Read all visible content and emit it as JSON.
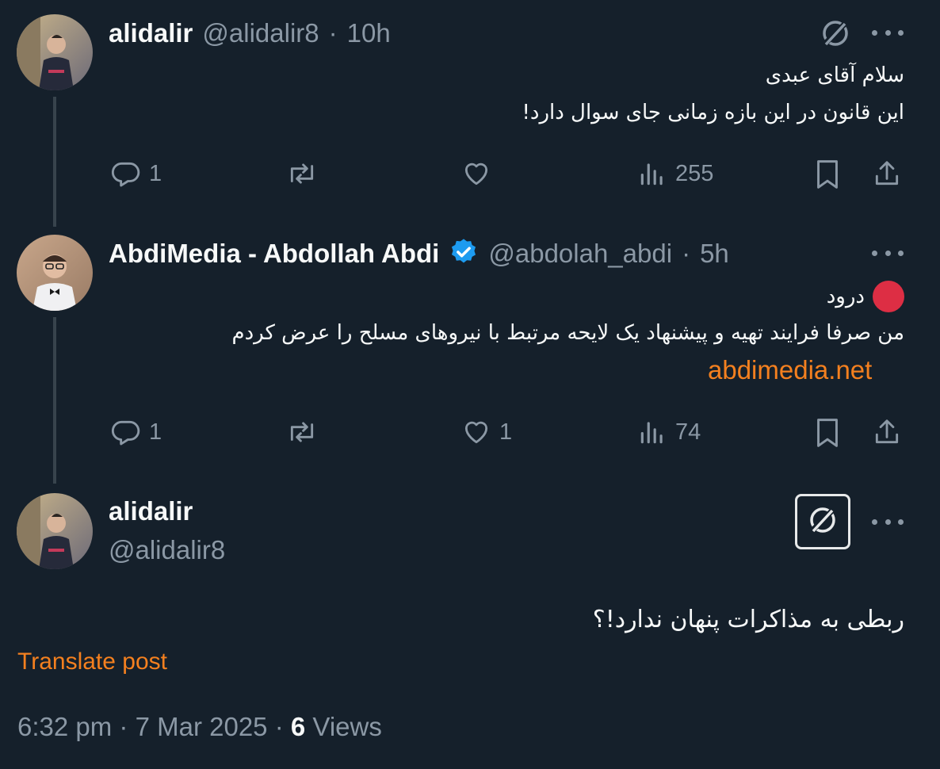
{
  "tweet1": {
    "name": "alidalir",
    "handle": "@alidalir8",
    "sep": "·",
    "time": "10h",
    "line1": "سلام آقای عبدی",
    "line2": "این قانون در این بازه زمانی جای سوال دارد!",
    "replies": "1",
    "likes": "",
    "views": "255"
  },
  "tweet2": {
    "name": "AbdiMedia - Abdollah Abdi",
    "handle": "@abdolah_abdi",
    "sep": "·",
    "time": "5h",
    "line1": "درود",
    "line2": "من صرفا فرایند تهیه و پیشنهاد یک لایحه مرتبط با نیروهای مسلح را عرض کردم",
    "link": "abdimedia.net",
    "replies": "1",
    "likes": "1",
    "views": "74"
  },
  "main_tweet": {
    "name": "alidalir",
    "handle": "@alidalir8",
    "text": "ربطی به مذاکرات پنهان ندارد!؟",
    "translate": "Translate post",
    "time": "6:32 pm",
    "sep1": "·",
    "date": "7 Mar 2025",
    "sep2": "·",
    "views_count": "6",
    "views_label": "Views"
  },
  "icons": {
    "grok": "grok-icon",
    "more": "more-icon",
    "reply": "reply-icon",
    "repost": "repost-icon",
    "like": "like-icon",
    "views": "views-icon",
    "bookmark": "bookmark-icon",
    "share": "share-icon",
    "verified": "verified-badge-icon",
    "red_circle": "red-circle-emoji"
  },
  "colors": {
    "background": "#15202b",
    "accent": "#f4801f",
    "muted": "#8b98a5",
    "verified": "#1d9bf0"
  }
}
